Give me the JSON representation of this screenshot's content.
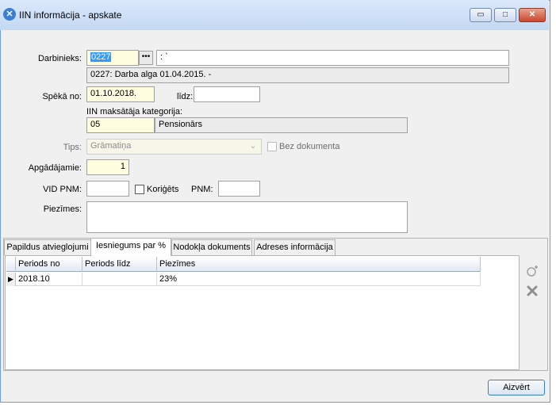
{
  "window": {
    "title": "IIN informācija - apskate",
    "controls": {
      "minimize": "▭",
      "maximize": "□",
      "close": "✕"
    }
  },
  "form": {
    "darbinieks": {
      "label": "Darbinieks:",
      "code": "0227",
      "lookup_button": "•••",
      "name": ": `",
      "info": "0227: Darba alga  01.04.2015. -"
    },
    "speka_no": {
      "label": "Spēkā no:",
      "value": "01.10.2018."
    },
    "lidz": {
      "label": "līdz:",
      "value": ""
    },
    "kategorija": {
      "label": "IIN maksātāja kategorija:",
      "code": "05",
      "name": "Pensionārs"
    },
    "tips": {
      "label": "Tips:",
      "value": "Grāmatiņa",
      "bez_dokumenta": "Bez dokumenta"
    },
    "apgadajamie": {
      "label": "Apgādājamie:",
      "value": "1"
    },
    "vid_pnm": {
      "label": "VID PNM:",
      "value": "",
      "koriggets": "Koriģēts",
      "pnm_label": "PNM:",
      "pnm_value": ""
    },
    "piezimes": {
      "label": "Piezīmes:",
      "value": ""
    }
  },
  "tabs": [
    {
      "label": "Papildus atvieglojumi",
      "active": false
    },
    {
      "label": "Iesniegums par %",
      "active": true
    },
    {
      "label": "Nodokļa dokuments",
      "active": false
    },
    {
      "label": "Adreses informācija",
      "active": false
    }
  ],
  "grid": {
    "columns": [
      "Periods no",
      "Periods līdz",
      "Piezīmes"
    ],
    "rows": [
      {
        "periods_no": "2018.10",
        "periods_lidz": "",
        "piezimes": "23%"
      }
    ]
  },
  "side_actions": {
    "add_icon": "add-icon",
    "delete_icon": "delete-icon"
  },
  "footer": {
    "close_button": "Aizvērt"
  }
}
